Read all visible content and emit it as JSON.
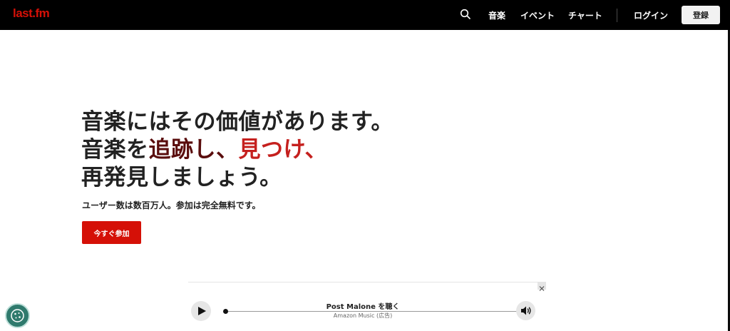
{
  "header": {
    "logo": {
      "part1": "last",
      "part2": ".fm"
    },
    "search_icon": "search-icon",
    "nav": [
      "音楽",
      "イベント",
      "チャート"
    ],
    "login": "ログイン",
    "signup": "登録"
  },
  "hero": {
    "line1": "音楽にはその価値があります。",
    "line2_prefix": "音楽を",
    "line2_mid": "追跡し、",
    "line2_accent": "見つけ",
    "line2_end": "、",
    "line3": "再発見しましょう。",
    "subtitle": "ユーザー数は数百万人。参加は完全無料です。",
    "cta": "今すぐ参加"
  },
  "ad": {
    "title": "Post Malone を聴く",
    "subtitle": "Amazon Music (広告)",
    "play_icon": "play-icon",
    "volume_icon": "volume-icon",
    "close_icon": "close-icon"
  },
  "cookie": {
    "icon": "cookie-icon"
  },
  "colors": {
    "header_bg": "#000000",
    "brand_red": "#d51007",
    "accent_red": "#c5201e",
    "dark_red": "#5a0d0d",
    "cookie_teal": "#2f7a6d"
  }
}
